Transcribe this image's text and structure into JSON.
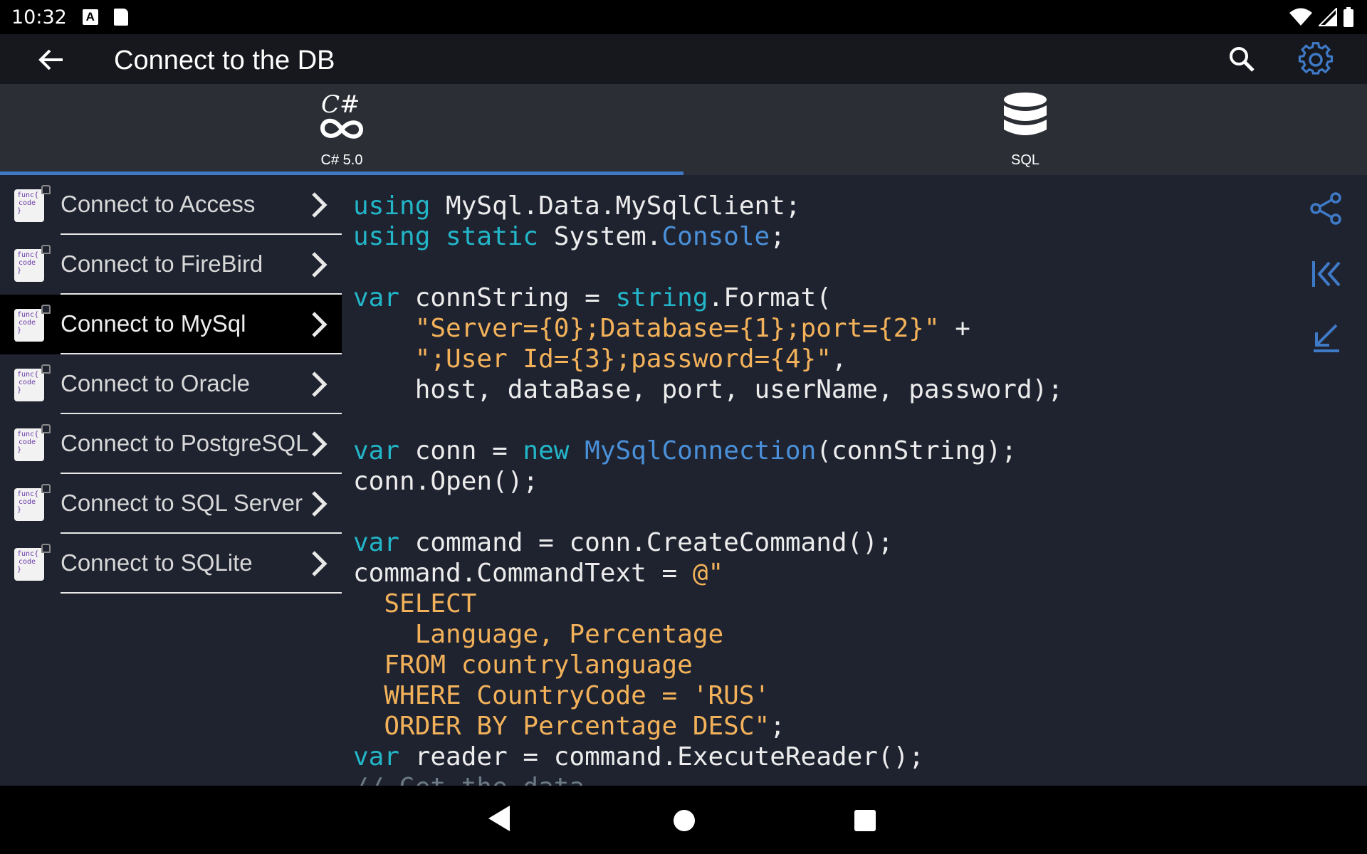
{
  "status_bar": {
    "time": "10:32",
    "notification_icons": [
      "a-icon",
      "sd-card-icon"
    ],
    "right_icons": [
      "wifi-icon",
      "signal-icon",
      "battery-icon"
    ]
  },
  "app_bar": {
    "title": "Connect to the DB",
    "back_icon": "arrow-left-icon",
    "search_icon": "search-icon",
    "settings_icon": "gear-icon"
  },
  "tabs": [
    {
      "label": "C# 5.0",
      "icon": "csharp-icon",
      "selected": true
    },
    {
      "label": "SQL",
      "icon": "database-icon",
      "selected": false
    }
  ],
  "sidebar": {
    "icon_text": [
      "func{",
      "code",
      "}"
    ],
    "items": [
      {
        "label": "Connect to Access",
        "selected": false
      },
      {
        "label": "Connect to FireBird",
        "selected": false
      },
      {
        "label": "Connect to MySql",
        "selected": true
      },
      {
        "label": "Connect to Oracle",
        "selected": false
      },
      {
        "label": "Connect to PostgreSQL",
        "selected": false
      },
      {
        "label": "Connect to SQL Server",
        "selected": false
      },
      {
        "label": "Connect to SQLite",
        "selected": false
      }
    ]
  },
  "code": {
    "language": "C#",
    "lines": [
      [
        [
          "kw",
          "using"
        ],
        [
          "t",
          " MySql.Data.MySqlClient;"
        ]
      ],
      [
        [
          "kw",
          "using static"
        ],
        [
          "t",
          " System."
        ],
        [
          "ty",
          "Console"
        ],
        [
          "t",
          ";"
        ]
      ],
      [],
      [
        [
          "kw",
          "var"
        ],
        [
          "t",
          " connString = "
        ],
        [
          "kw",
          "string"
        ],
        [
          "t",
          ".Format("
        ]
      ],
      [
        [
          "t",
          "    "
        ],
        [
          "st",
          "\"Server={0};Database={1};port={2}\""
        ],
        [
          "t",
          " +"
        ]
      ],
      [
        [
          "t",
          "    "
        ],
        [
          "st",
          "\";User Id={3};password={4}\""
        ],
        [
          "t",
          ","
        ]
      ],
      [
        [
          "t",
          "    host, dataBase, port, userName, password);"
        ]
      ],
      [],
      [
        [
          "kw",
          "var"
        ],
        [
          "t",
          " conn = "
        ],
        [
          "kw",
          "new"
        ],
        [
          "t",
          " "
        ],
        [
          "ty",
          "MySqlConnection"
        ],
        [
          "t",
          "(connString);"
        ]
      ],
      [
        [
          "t",
          "conn.Open();"
        ]
      ],
      [],
      [
        [
          "kw",
          "var"
        ],
        [
          "t",
          " command = conn.CreateCommand();"
        ]
      ],
      [
        [
          "t",
          "command.CommandText = "
        ],
        [
          "st",
          "@\""
        ]
      ],
      [
        [
          "st",
          "  SELECT"
        ]
      ],
      [
        [
          "st",
          "    Language, Percentage"
        ]
      ],
      [
        [
          "st",
          "  FROM countrylanguage"
        ]
      ],
      [
        [
          "st",
          "  WHERE CountryCode = 'RUS'"
        ]
      ],
      [
        [
          "st",
          "  ORDER BY Percentage DESC\""
        ],
        [
          "t",
          ";"
        ]
      ],
      [
        [
          "kw",
          "var"
        ],
        [
          "t",
          " reader = command.ExecuteReader();"
        ]
      ],
      [
        [
          "cm",
          "// Get the data"
        ]
      ]
    ]
  },
  "tools": [
    "share-icon",
    "scroll-top-icon",
    "scroll-bottom-icon"
  ],
  "colors": {
    "background": "#1f2330",
    "app_bar": "#16181d",
    "tab_bar": "#2b2e34",
    "accent": "#3f7ac7",
    "keyword": "#22b6c8",
    "type": "#4a90d9",
    "string": "#f3b25a"
  }
}
